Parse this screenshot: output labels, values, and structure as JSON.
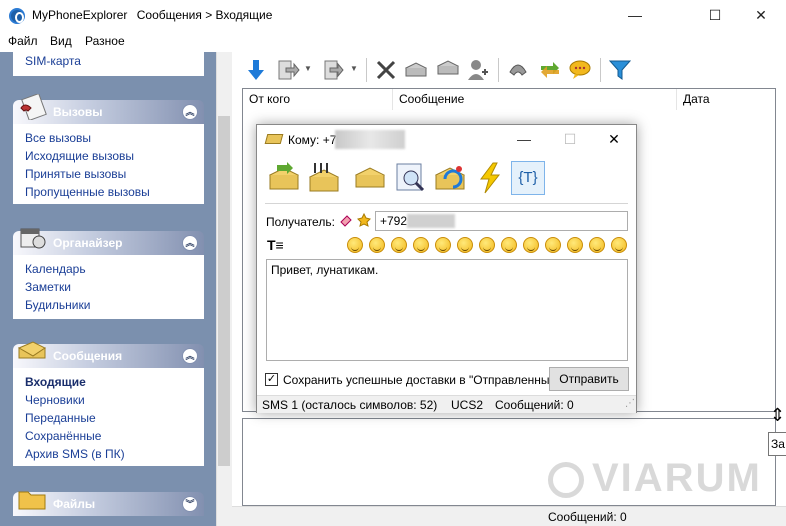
{
  "window": {
    "app_name": "MyPhoneExplorer",
    "path": "Сообщения > Входящие",
    "controls": [
      "—",
      "☐",
      "✕"
    ]
  },
  "menu": [
    "Файл",
    "Вид",
    "Разное"
  ],
  "sidebar": {
    "top_item": "SIM-карта",
    "sections": [
      {
        "title": "Вызовы",
        "icon": "phone-list-icon",
        "items": [
          "Все вызовы",
          "Исходящие вызовы",
          "Принятые вызовы",
          "Пропущенные вызовы"
        ]
      },
      {
        "title": "Органайзер",
        "icon": "organizer-icon",
        "items": [
          "Календарь",
          "Заметки",
          "Будильники"
        ]
      },
      {
        "title": "Сообщения",
        "icon": "envelope-icon",
        "items": [
          "Входящие",
          "Черновики",
          "Переданные",
          "Сохранённые",
          "Архив SMS (в ПК)"
        ],
        "active": "Входящие"
      },
      {
        "title": "Файлы",
        "icon": "folder-icon",
        "items": []
      }
    ],
    "collapse_glyph": "︽"
  },
  "list": {
    "columns": [
      "От кого",
      "Сообщение",
      "Дата"
    ]
  },
  "status": {
    "messages": "Сообщений: 0"
  },
  "tooltip": "За",
  "watermark": "VIARUM",
  "dialog": {
    "title_prefix": "Кому: +79",
    "controls": [
      "—",
      "☐",
      "✕"
    ],
    "recipient_label": "Получатель:",
    "recipient_value": "+792",
    "message_text": "Привет, лунатикам.",
    "save_label": "Сохранить успешные доставки в \"Отправленные\"",
    "save_checked": "✓",
    "send_label": "Отправить",
    "status": {
      "sms": "SMS 1 (осталось символов: 52)",
      "encoding": "UCS2",
      "messages": "Сообщений: 0"
    },
    "text_format_glyph": "T≡",
    "template_glyph": "{T}"
  },
  "colors": {
    "sidebar_bg": "#7b90ae",
    "link": "#1a3e96",
    "toolbar_blue": "#1e7ad8",
    "accent_yellow": "#f2b81d"
  }
}
